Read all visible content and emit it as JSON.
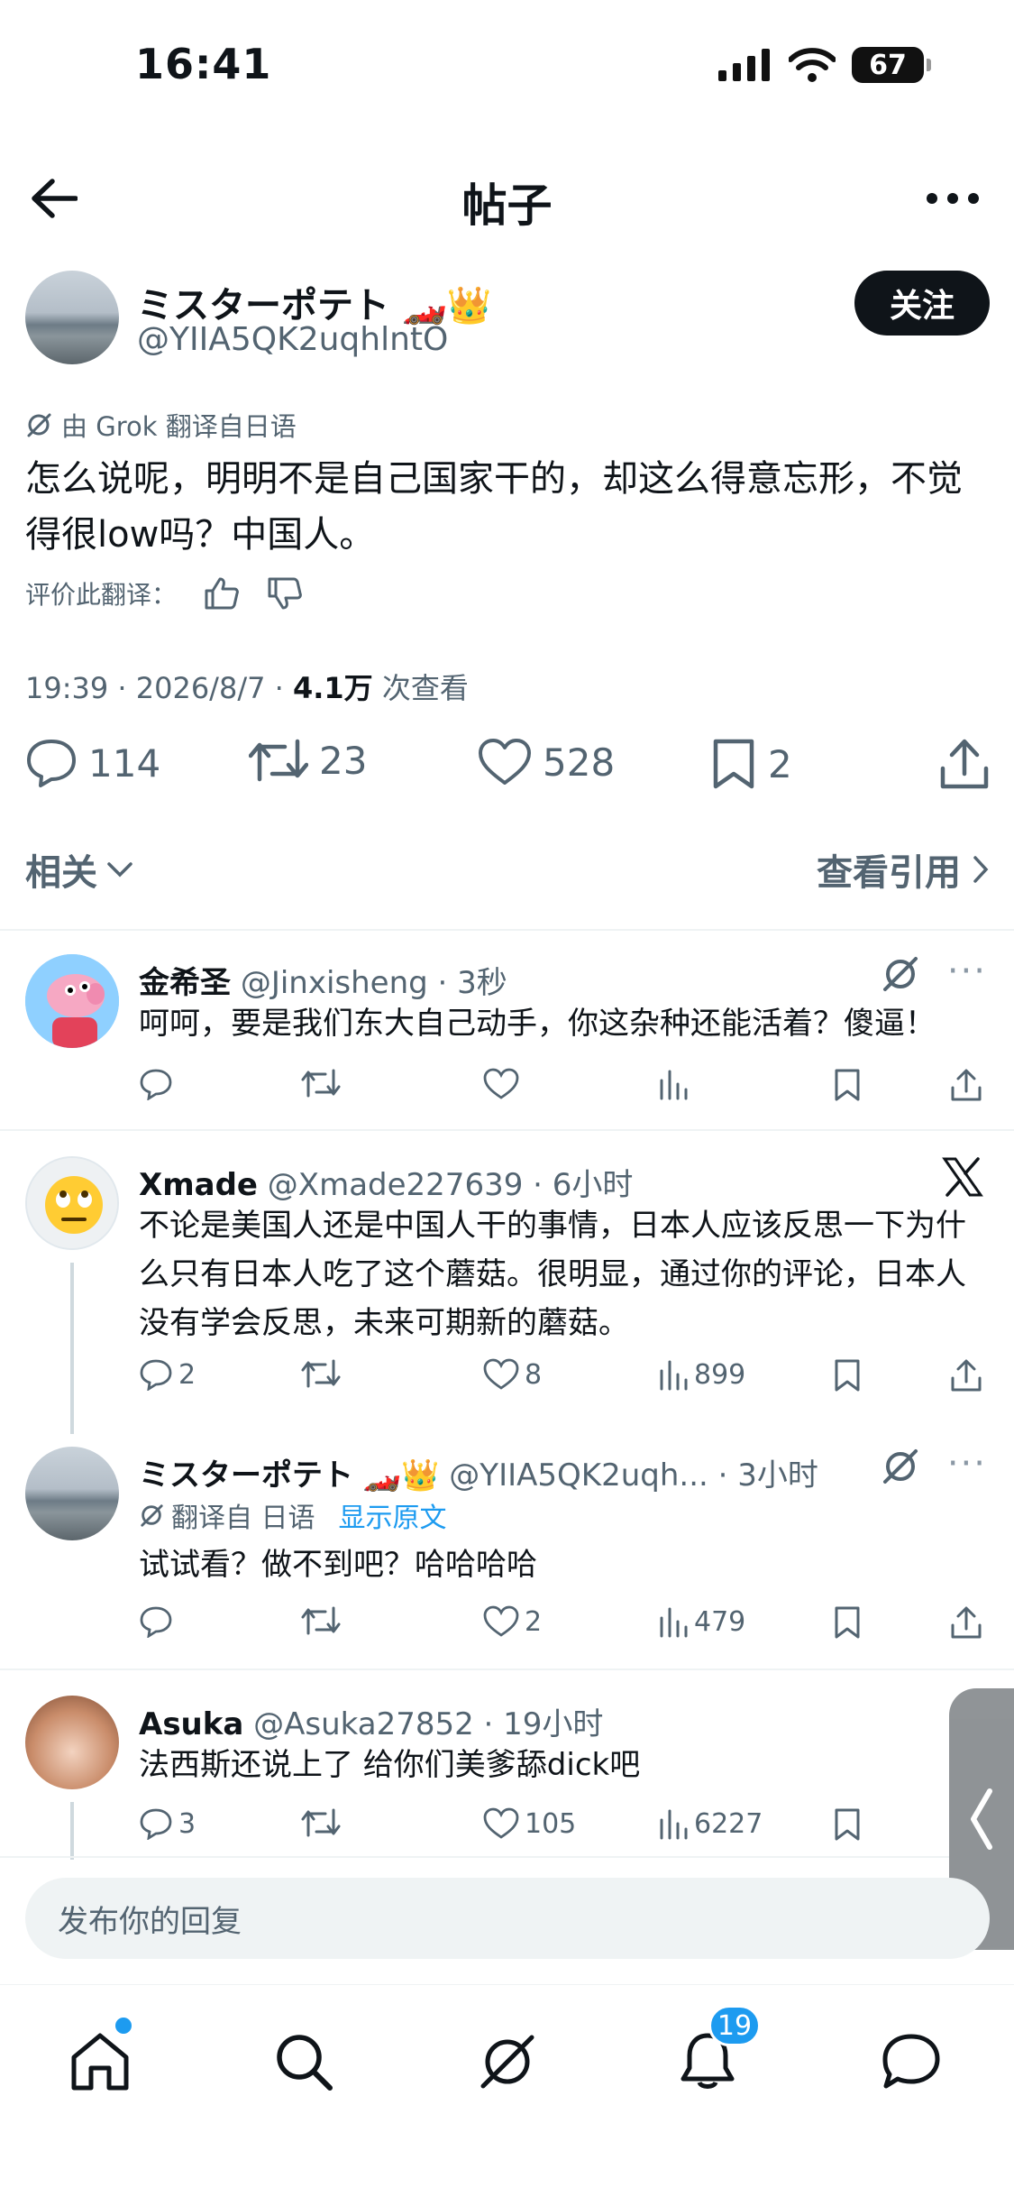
{
  "status_bar": {
    "time": "16:41",
    "battery": "67"
  },
  "header": {
    "title": "帖子"
  },
  "post": {
    "author_name": "ミスターポテト",
    "author_emoji": "🏎️👑",
    "author_handle": "@YIIA5QK2uqhlntO",
    "follow_label": "关注",
    "translate_note": "由 Grok 翻译自日语",
    "text": "怎么说呢，明明不是自己国家干的，却这么得意忘形，不觉得很low吗？中国人。",
    "rate_label": "评价此翻译：",
    "meta_prefix": "19:39 · 2026/8/7 · ",
    "views": "4.1万",
    "views_suffix": " 次查看",
    "replies": "114",
    "reposts": "23",
    "likes": "528",
    "bookmarks": "2"
  },
  "related": {
    "left_label": "相关",
    "right_label": "查看引用"
  },
  "replies": [
    {
      "name": "金希圣",
      "handle": "@Jinxisheng · 3秒",
      "text": "呵呵，要是我们东大自己动手，你这杂种还能活着？傻逼！",
      "replies": "",
      "reposts": "",
      "likes": "",
      "views": ""
    },
    {
      "name": "Xmade",
      "handle": "@Xmade227639 · 6小时",
      "text": "不论是美国人还是中国人干的事情，日本人应该反思一下为什么只有日本人吃了这个蘑菇。很明显，通过你的评论，日本人没有学会反思，未来可期新的蘑菇。",
      "replies": "2",
      "reposts": "",
      "likes": "8",
      "views": "899"
    },
    {
      "name": "ミスターポテト",
      "name_emoji": "🏎️👑",
      "handle": "@YIIA5QK2uqh... · 3小时",
      "translate_note": "翻译自 日语",
      "show_original": "显示原文",
      "text": "试试看？做不到吧？哈哈哈哈",
      "replies": "",
      "reposts": "",
      "likes": "2",
      "views": "479"
    },
    {
      "name": "Asuka",
      "handle": "@Asuka27852 · 19小时",
      "text": "法西斯还说上了 给你们美爹舔dick吧",
      "replies": "3",
      "reposts": "",
      "likes": "105",
      "views": "6227"
    }
  ],
  "reply_input": {
    "placeholder": "发布你的回复"
  },
  "tab_bar": {
    "notifications_badge": "19"
  },
  "colors": {
    "accent": "#1d9bf0",
    "text": "#0f1419",
    "secondary": "#536471"
  }
}
